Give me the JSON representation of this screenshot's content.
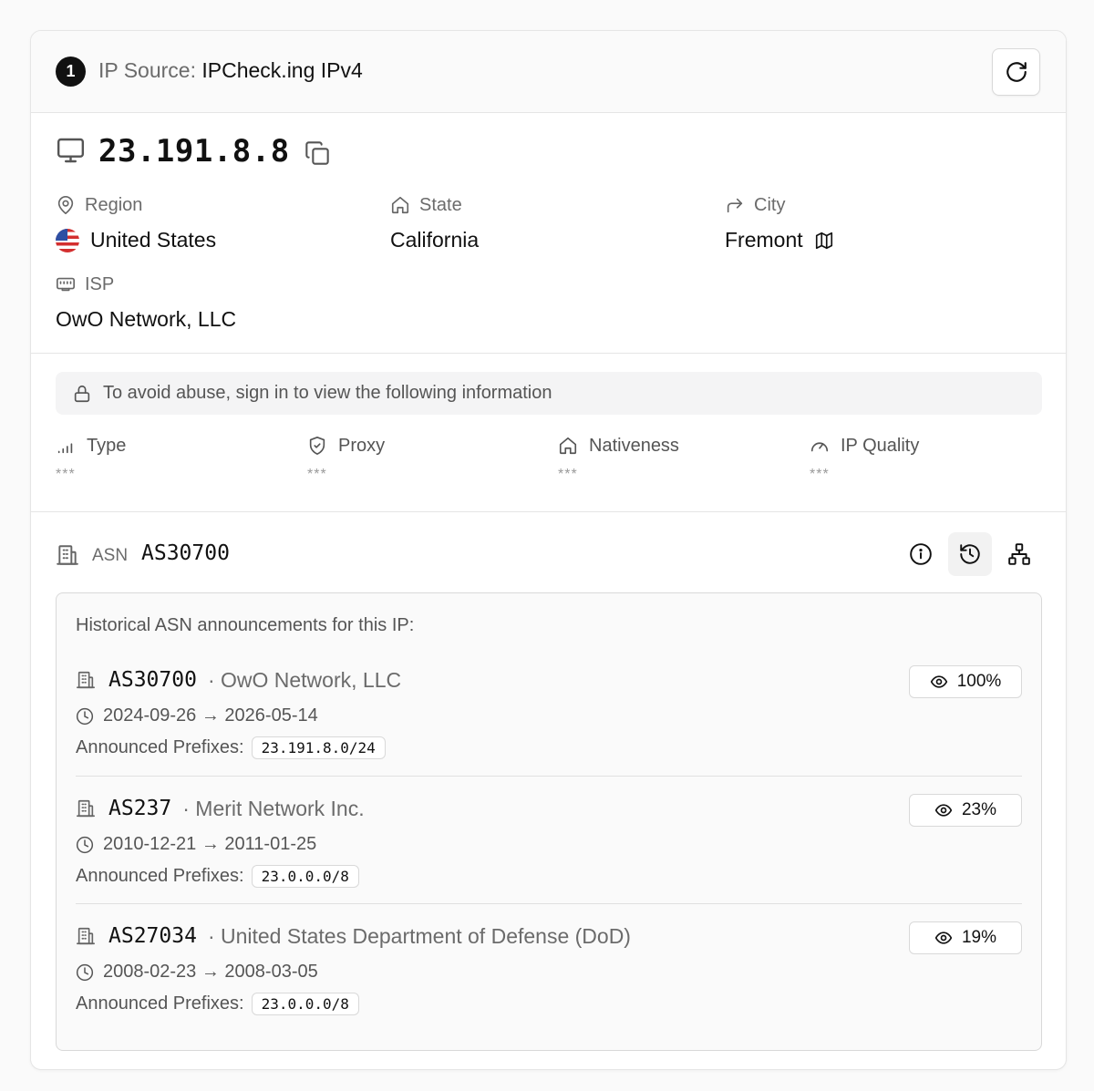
{
  "header": {
    "step": "1",
    "source_label": "IP Source:",
    "source_value": "IPCheck.ing IPv4"
  },
  "ip": {
    "address": "23.191.8.8"
  },
  "location": {
    "region_label": "Region",
    "region_value": "United States",
    "state_label": "State",
    "state_value": "California",
    "city_label": "City",
    "city_value": "Fremont",
    "isp_label": "ISP",
    "isp_value": "OwO Network, LLC"
  },
  "restricted": {
    "notice": "To avoid abuse, sign in to view the following information",
    "metrics": [
      {
        "label": "Type",
        "value": "***"
      },
      {
        "label": "Proxy",
        "value": "***"
      },
      {
        "label": "Nativeness",
        "value": "***"
      },
      {
        "label": "IP Quality",
        "value": "***"
      }
    ]
  },
  "asn": {
    "label": "ASN",
    "value": "AS30700",
    "history_title": "Historical ASN announcements for this IP:",
    "prefix_label": "Announced Prefixes:",
    "entries": [
      {
        "asn": "AS30700",
        "org": "· OwO Network, LLC",
        "dates": "2024-09-26 → 2026-05-14",
        "prefix": "23.191.8.0/24",
        "percent": "100%"
      },
      {
        "asn": "AS237",
        "org": "· Merit Network Inc.",
        "dates": "2010-12-21 → 2011-01-25",
        "prefix": "23.0.0.0/8",
        "percent": "23%"
      },
      {
        "asn": "AS27034",
        "org": "· United States Department of Defense (DoD)",
        "dates": "2008-02-23 → 2008-03-05",
        "prefix": "23.0.0.0/8",
        "percent": "19%"
      }
    ]
  },
  "icons": {
    "refresh": "refresh-icon",
    "ip": "monitor-icon",
    "copy": "copy-icon",
    "region": "map-pin-icon",
    "state": "home-icon",
    "city": "forward-arrow-icon",
    "map": "map-icon",
    "isp": "network-card-icon",
    "lock": "lock-icon",
    "type": "signal-icon",
    "proxy": "shield-icon",
    "nativeness": "home-icon",
    "quality": "gauge-icon",
    "asn": "building-icon",
    "info": "info-icon",
    "history": "history-icon",
    "topology": "network-icon",
    "eye": "eye-icon",
    "clock": "clock-icon"
  },
  "colors": {
    "accent": "#111111",
    "muted": "#6b6b6b",
    "border": "#e5e5e5"
  }
}
